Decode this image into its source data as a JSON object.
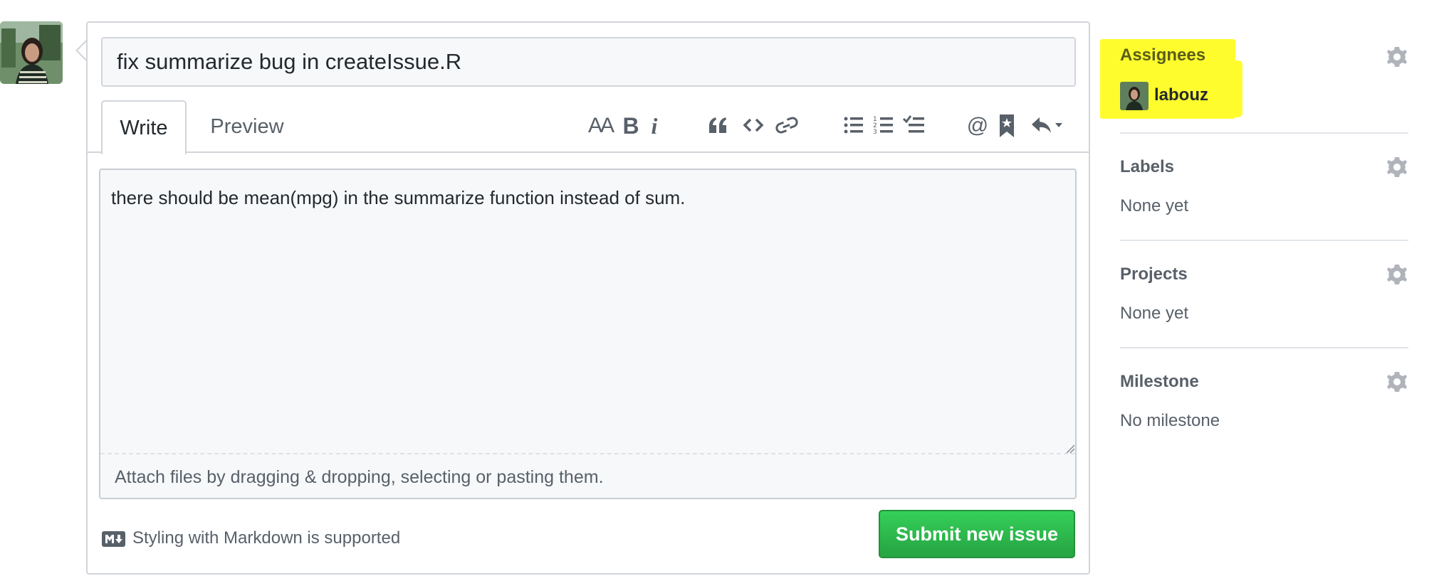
{
  "issue": {
    "title_value": "fix summarize bug in createIssue.R",
    "body_value": "there should be mean(mpg) in the summarize function instead of sum.",
    "attach_hint": "Attach files by dragging & dropping, selecting or pasting them.",
    "markdown_note": "Styling with Markdown is supported",
    "submit_label": "Submit new issue"
  },
  "tabs": [
    {
      "label": "Write",
      "active": true
    },
    {
      "label": "Preview",
      "active": false
    }
  ],
  "toolbar": {
    "header_glyph": "AA",
    "bold_glyph": "B",
    "italic_glyph": "i",
    "mention_glyph": "@",
    "icons": [
      "header-icon",
      "bold-icon",
      "italic-icon",
      "quote-icon",
      "code-icon",
      "link-icon",
      "unordered-list-icon",
      "ordered-list-icon",
      "task-list-icon",
      "mention-icon",
      "saved-reply-icon",
      "reply-icon"
    ]
  },
  "sidebar": {
    "assignees": {
      "heading": "Assignees",
      "user": "labouz"
    },
    "labels": {
      "heading": "Labels",
      "value": "None yet"
    },
    "projects": {
      "heading": "Projects",
      "value": "None yet"
    },
    "milestone": {
      "heading": "Milestone",
      "value": "No milestone"
    }
  },
  "colors": {
    "accent_green": "#28a745",
    "highlight": "#fffc2e",
    "border": "#d1d5da",
    "muted_text": "#586069"
  }
}
